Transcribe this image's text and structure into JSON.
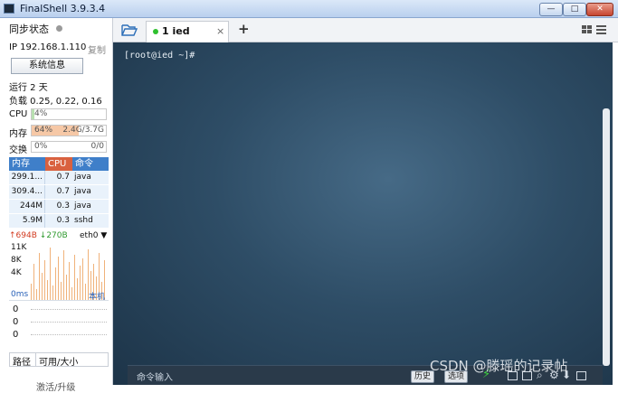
{
  "window": {
    "title": "FinalShell 3.9.3.4",
    "min": "—",
    "max": "□",
    "close": "✕"
  },
  "sidebar": {
    "sync_label": "同步状态",
    "ip_label": "IP 192.168.1.110",
    "copy_label": "复制",
    "sysinfo_button": "系统信息",
    "uptime": "运行 2 天",
    "load": "负载 0.25, 0.22, 0.16",
    "cpu": {
      "label": "CPU",
      "value": "4%",
      "percent": 4
    },
    "mem": {
      "label": "内存",
      "value": "64%",
      "detail": "2.4G/3.7G",
      "percent": 64
    },
    "swap": {
      "label": "交换",
      "value": "0%",
      "detail": "0/0",
      "percent": 0
    },
    "proc_headers": [
      "内存",
      "CPU",
      "命令"
    ],
    "processes": [
      {
        "mem": "299.1...",
        "cpu": "0.7",
        "cmd": "java"
      },
      {
        "mem": "309.4...",
        "cpu": "0.7",
        "cmd": "java"
      },
      {
        "mem": "244M",
        "cpu": "0.3",
        "cmd": "java"
      },
      {
        "mem": "5.9M",
        "cpu": "0.3",
        "cmd": "sshd"
      }
    ],
    "net": {
      "up": "694B",
      "down": "270B",
      "iface": "eth0",
      "ticks": [
        "11K",
        "8K",
        "4K"
      ]
    },
    "ping": {
      "label": "0ms",
      "host": "本机",
      "values": [
        "0",
        "0",
        "0"
      ]
    },
    "disk": {
      "path_header": "路径",
      "size_header": "可用/大小"
    },
    "bottom_text": "激活/升级"
  },
  "tabs": {
    "active_label": "1 ied",
    "close": "×",
    "add": "+"
  },
  "terminal": {
    "prompt": "[root@ied ~]#"
  },
  "cmdbar": {
    "placeholder": "命令输入",
    "history": "历史",
    "options": "选项"
  },
  "watermark": "CSDN @滕瑶的记录帖",
  "colors": {
    "titlebar": "#c5d8f1",
    "terminal_bg": "#2e4d66",
    "proc_header_mem": "#3f7fc9",
    "proc_header_cpu": "#d9613f",
    "mem_fill": "#f6c8a6",
    "status_green": "#2ec02e"
  }
}
